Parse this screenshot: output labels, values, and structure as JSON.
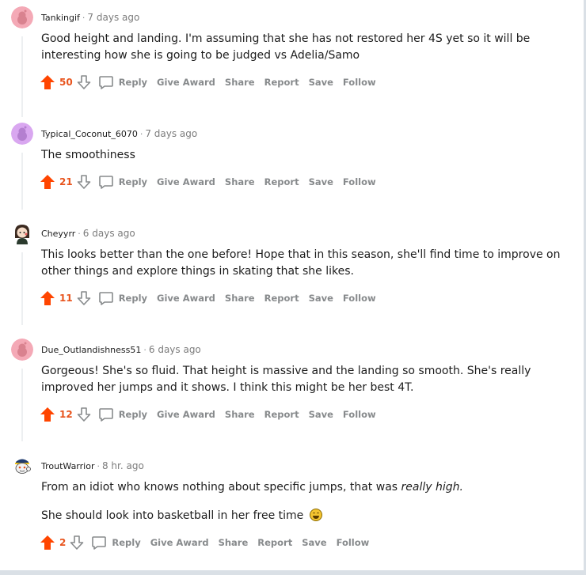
{
  "actions": {
    "reply": "Reply",
    "give_award": "Give Award",
    "share": "Share",
    "report": "Report",
    "save": "Save",
    "follow": "Follow"
  },
  "separator": "·",
  "comments": [
    {
      "author": "Tankingif",
      "time": "7 days ago",
      "body": "Good height and landing. I'm assuming that she has not restored her 4S yet so it will be interesting how she is going to be judged vs Adelia/Samo",
      "score": "50"
    },
    {
      "author": "Typical_Coconut_6070",
      "time": "7 days ago",
      "body": "The smoothiness",
      "score": "21"
    },
    {
      "author": "Cheyyrr",
      "time": "6 days ago",
      "body": "This looks better than the one before! Hope that in this season, she'll find time to improve on other things and explore things in skating that she likes.",
      "score": "11"
    },
    {
      "author": "Due_Outlandishness51",
      "time": "6 days ago",
      "body": "Gorgeous! She's so fluid. That height is massive and the landing so smooth. She's really improved her jumps and it shows. I think this might be her best 4T.",
      "score": "12"
    },
    {
      "author": "TroutWarrior",
      "time": "8 hr. ago",
      "body_line1_prefix": "From an idiot who knows nothing about specific jumps, that was ",
      "body_line1_emph": "really high.",
      "body_line2": "She should look into basketball in her free time",
      "score": "2"
    }
  ],
  "colors": {
    "upvote": "#ff4500",
    "score": "#e8541d",
    "meta_gray": "#878a8c",
    "avatar_pink": "#f4a9b6",
    "avatar_purple": "#d9a7f0"
  }
}
